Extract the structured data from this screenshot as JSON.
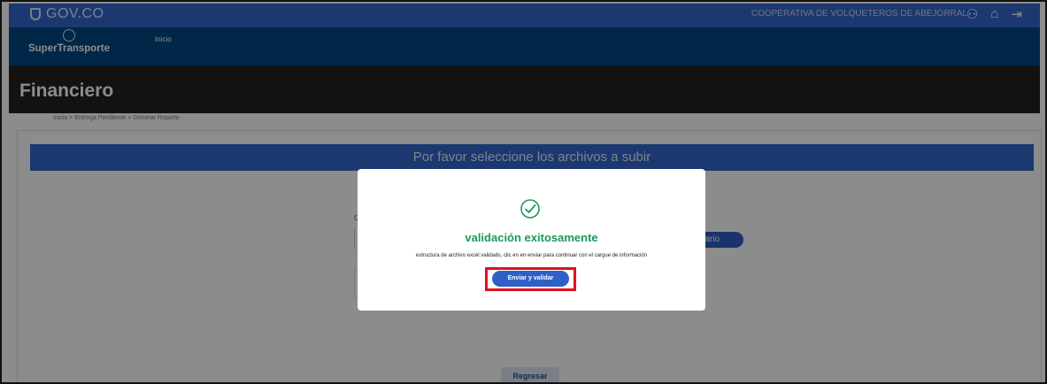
{
  "govbar": {
    "logo_text": "GOV.CO",
    "cooperative": "COOPERATIVA DE VOLQUETEROS DE ABEJORRAL",
    "icons": [
      "user-icon",
      "home-icon",
      "logout-icon"
    ]
  },
  "navbar": {
    "brand": "SuperTransporte",
    "inicio": "Inicio"
  },
  "page": {
    "title": "Financiero",
    "breadcrumb": "Inicio  >  Entrega Pendiente  >  Generar Reporte"
  },
  "section": {
    "header": "Por favor seleccione los archivos a subir",
    "label_partial": "C",
    "pill_partial": "ilario",
    "back_button": "Regresar"
  },
  "modal": {
    "icon": "check-circle-icon",
    "title": "validación exitosamente",
    "message": "estructura de archivo excel validado, clic en en enviar para continuar con el cargue de información",
    "send_button": "Enviar y validar",
    "highlight_color": "#e0121c",
    "title_color": "#1a9a5a"
  }
}
